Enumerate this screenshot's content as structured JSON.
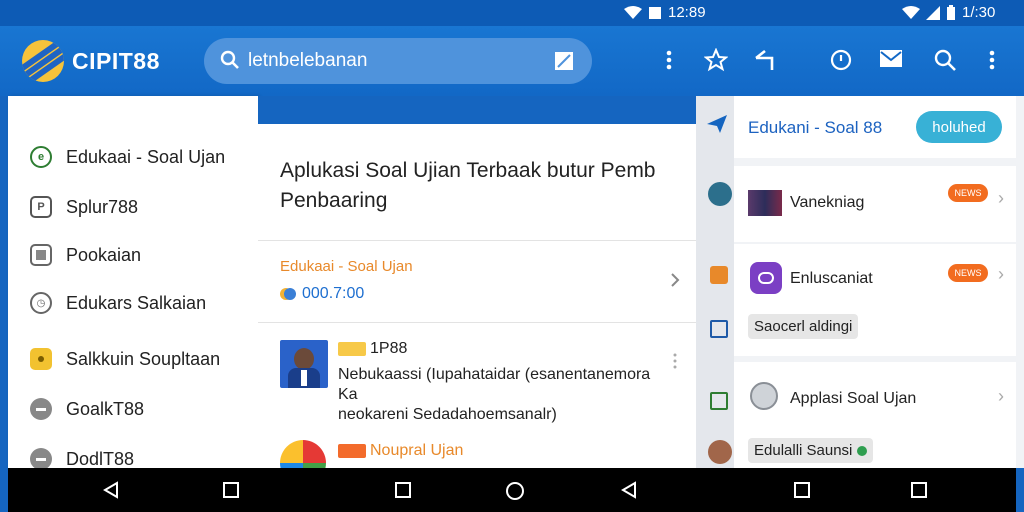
{
  "status": {
    "left_time": "12:89",
    "right_time": "1/:30"
  },
  "appbar": {
    "brand": "CIPIT88",
    "search_query": "letnbelebanan"
  },
  "drawer": {
    "items": [
      {
        "label": "Edukaai - Soal Ujan",
        "icon": "e-icon",
        "color": "#2e7d32"
      },
      {
        "label": "Splur788",
        "icon": "p-icon",
        "color": "#555555"
      },
      {
        "label": "Pookaian",
        "icon": "square-icon",
        "color": "#666666"
      },
      {
        "label": "Edukars Salkaian",
        "icon": "clock-icon",
        "color": "#666666"
      },
      {
        "label": "Salkkuin Soupltaan",
        "icon": "yellow-square-icon",
        "color": "#f2c230"
      },
      {
        "label": "GoalkT88",
        "icon": "circle-icon",
        "color": "#888888"
      },
      {
        "label": "DodlT88",
        "icon": "circle-icon",
        "color": "#888888"
      }
    ]
  },
  "middle": {
    "title": "Aplukasi Soal Ujian Terbaak butur Pemb Penbaaring",
    "category": "Edukaai - Soal Ujan",
    "price": "000.7:00",
    "row1_title": "1P88",
    "row1_line1": "Nebukaassi (Iupahataidar (esanentanemora",
    "row1_line2": "Ka",
    "row1_line3": "neokareni Sedadahoemsanalr)",
    "row2_title": "Noupral Ujan"
  },
  "right": {
    "header": "Edukani - Soal 88",
    "pill": "holuhed",
    "card1_name": "Vanekniag",
    "card1_badge": "NEWS",
    "card2_name": "Enluscaniat",
    "card2_badge": "NEWS",
    "card2_chip": "Saocerl aldingi",
    "card3_name": "Applasi Soal Ujan",
    "card3_chip": "Edulalli Saunsi"
  },
  "colors": {
    "primary": "#1976d2",
    "accent_orange": "#e8892a",
    "badge": "#f26c1f",
    "pill": "#38b1d6"
  }
}
